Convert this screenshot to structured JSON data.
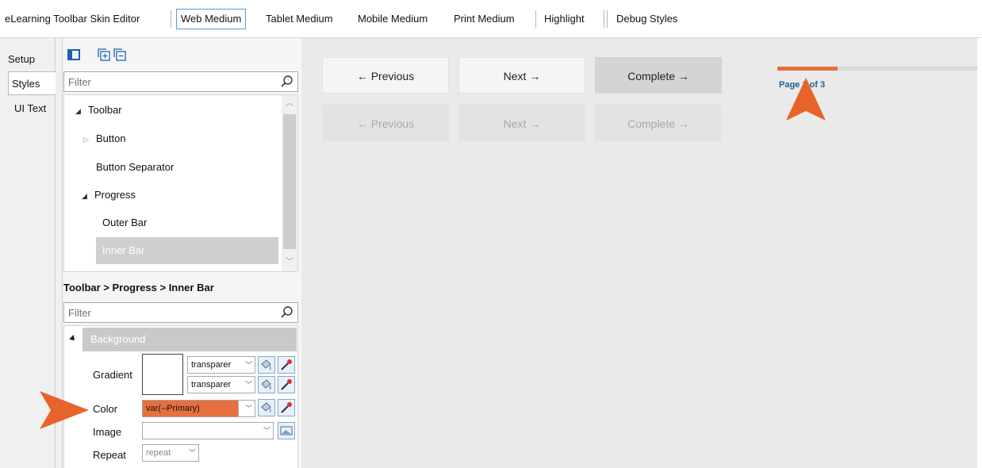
{
  "topbar": {
    "tabs": [
      {
        "label": "eLearning Toolbar Skin Editor"
      },
      {
        "label": "Web Medium"
      },
      {
        "label": "Tablet Medium"
      },
      {
        "label": "Mobile Medium"
      },
      {
        "label": "Print Medium"
      },
      {
        "label": "Highlight"
      },
      {
        "label": "Debug Styles"
      }
    ],
    "active": "Web Medium"
  },
  "vtabs": [
    {
      "label": "Setup"
    },
    {
      "label": "Styles"
    },
    {
      "label": "UI Text"
    }
  ],
  "tree": {
    "filter_placeholder": "Filter",
    "items": [
      {
        "label": "Toolbar",
        "expander": "expanded"
      },
      {
        "label": "Button",
        "expander": "collapsed"
      },
      {
        "label": "Button Separator"
      },
      {
        "label": "Progress",
        "expander": "expanded"
      },
      {
        "label": "Outer Bar"
      },
      {
        "label": "Inner Bar",
        "selected": true
      }
    ]
  },
  "breadcrumb": "Toolbar > Progress > Inner Bar",
  "props": {
    "filter_placeholder": "Filter",
    "section": "Background",
    "gradient_label": "Gradient",
    "gradient_start": "transparer",
    "gradient_end": "transparer",
    "color_label": "Color",
    "color_value": "var(--Primary)",
    "image_label": "Image",
    "image_value": "",
    "repeat_label": "Repeat",
    "repeat_value": "repeat"
  },
  "preview": {
    "row1": {
      "previous": "← Previous",
      "next": "Next →",
      "complete": "Complete →"
    },
    "row2": {
      "previous": "← Previous",
      "next": "Next →",
      "complete": "Complete →"
    },
    "page_text": "Page 1 of 3",
    "progress_fraction": 0.3
  },
  "colors": {
    "accent": "#e6703d",
    "page_text": "#1f5f8b",
    "callout": "#e8632b"
  }
}
